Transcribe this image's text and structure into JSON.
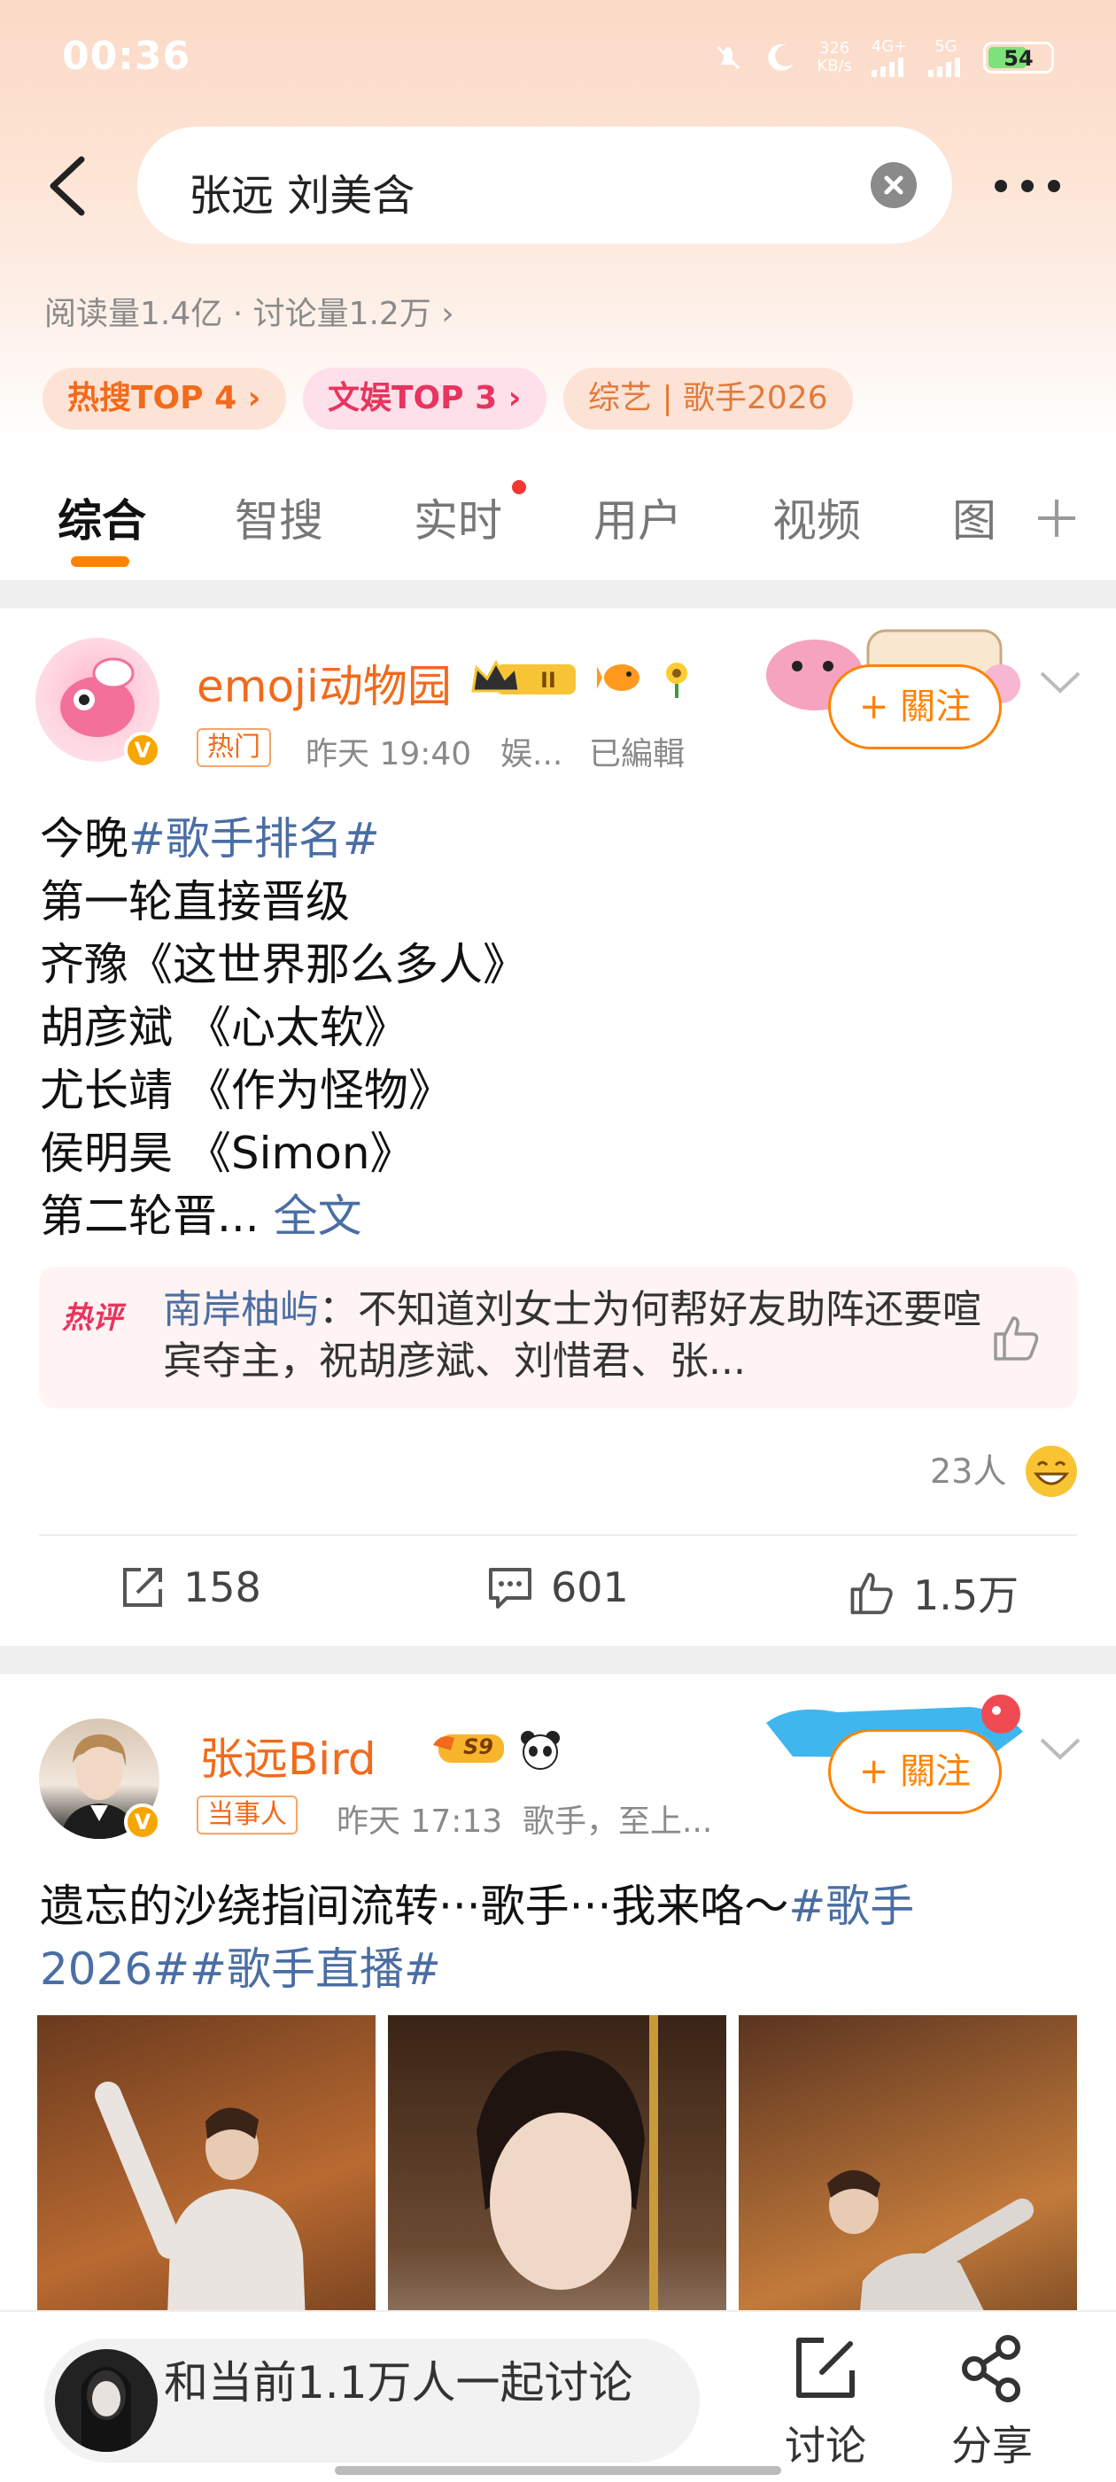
{
  "status_bar": {
    "time": "00:36",
    "net_speed": "326",
    "net_unit": "KB/s",
    "net_type": "4G+",
    "net_5g": "5G",
    "battery": "54"
  },
  "search": {
    "query": "张远 刘美含"
  },
  "meta": {
    "stats": "阅读量1.4亿 · 讨论量1.2万 ›"
  },
  "chips": [
    "热搜TOP 4 ›",
    "文娱TOP 3 ›",
    "综艺 | 歌手2026"
  ],
  "tabs": [
    "综合",
    "智搜",
    "实时",
    "用户",
    "视频",
    "图"
  ],
  "post1": {
    "username": "emoji动物园",
    "tag": "热门",
    "time": "昨天 19:40",
    "source": "娱...",
    "edited": "已編輯",
    "follow": "+ 關注",
    "line1_prefix": "今晚",
    "line1_topic": "#歌手排名#",
    "lines": [
      "第一轮直接晋级",
      "齐豫《这世界那么多人》",
      "胡彦斌 《心太软》",
      "尤长靖 《作为怪物》",
      "侯明昊 《Simon》"
    ],
    "last_line": "第二轮晋...",
    "more": "全文",
    "hot_badge": "热评",
    "hot_name": "南岸柚屿",
    "hot_text": "：不知道刘女士为何帮好友助阵还要喧宾夺主，祝胡彦斌、刘惜君、张...",
    "reactions": "23人",
    "repost": "158",
    "comment": "601",
    "like": "1.5万"
  },
  "post2": {
    "username": "张远Bird",
    "level": "S9",
    "tag": "当事人",
    "time": "昨天 17:13",
    "source": "歌手，至上...",
    "follow": "+ 關注",
    "text_plain": "遗忘的沙绕指间流转···歌手···我来咯～",
    "topic1": "#歌手",
    "topic1b": "2026#",
    "topic2": "#歌手直播#"
  },
  "bottom": {
    "discuss": "和当前1.1万人一起讨论",
    "btn_discuss": "讨论",
    "btn_share": "分享"
  },
  "colors": {
    "accent": "#ff8200",
    "link": "#4a6ea3",
    "username": "#f26a1b"
  }
}
